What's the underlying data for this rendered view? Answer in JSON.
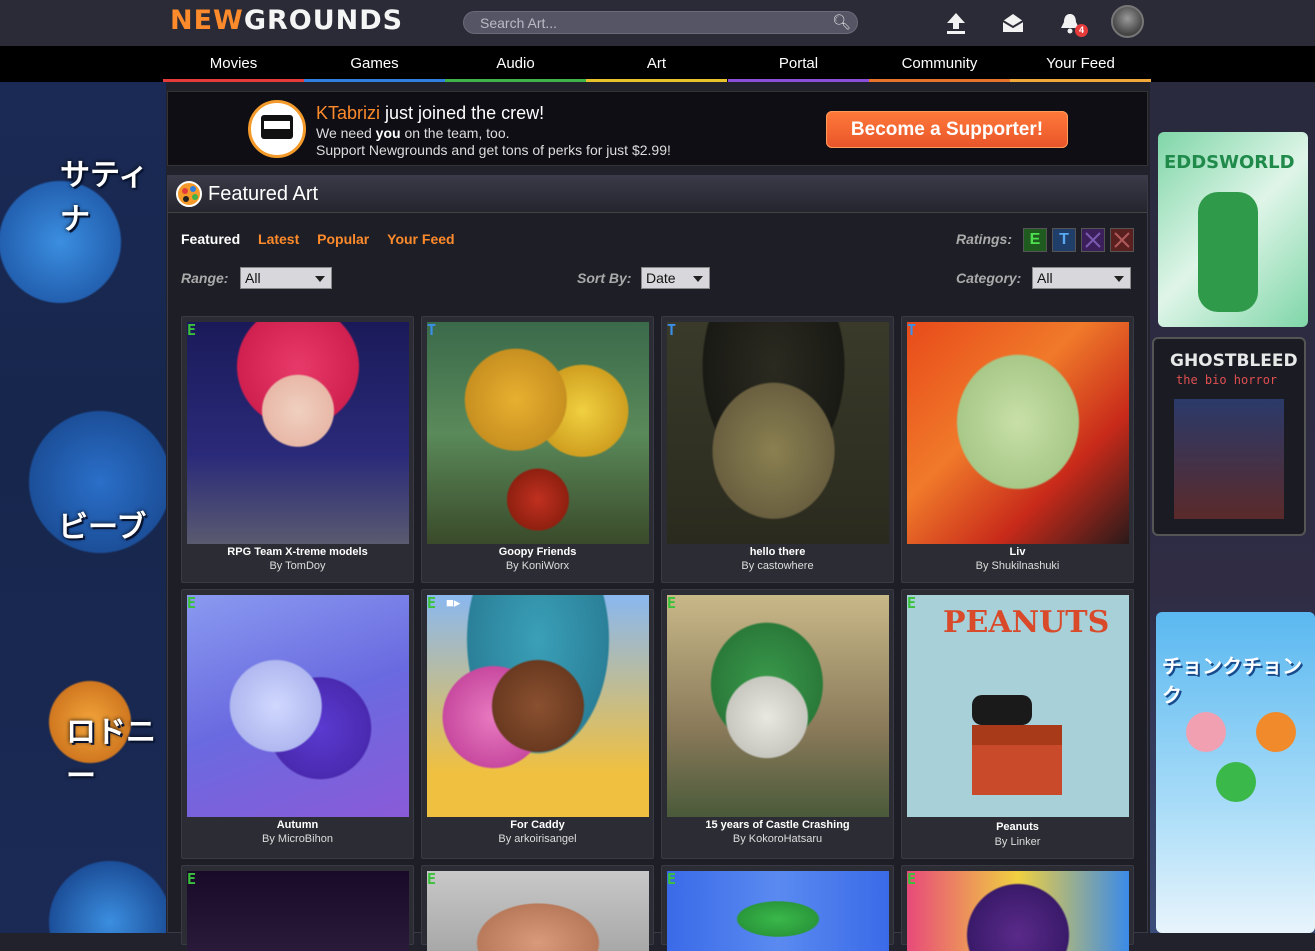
{
  "brand": {
    "logo_new": "NEW",
    "logo_grounds": "GROUNDS"
  },
  "search": {
    "placeholder": "Search Art..."
  },
  "notifications": {
    "count": "4"
  },
  "nav": [
    {
      "label": "Movies",
      "color": "#e53b3b"
    },
    {
      "label": "Games",
      "color": "#2f7fe0"
    },
    {
      "label": "Audio",
      "color": "#3fb24a"
    },
    {
      "label": "Art",
      "color": "#e8c22a"
    },
    {
      "label": "Portal",
      "color": "#8a4fd8"
    },
    {
      "label": "Community",
      "color": "#e8732a"
    },
    {
      "label": "Your Feed",
      "color": "#f2a93a"
    }
  ],
  "banner": {
    "username": "KTabrizi",
    "joined_text": " just joined the crew!",
    "line2_pre": "We need ",
    "line2_bold": "you",
    "line2_post": " on the team, too.",
    "line3": "Support Newgrounds and get tons of perks for just $2.99!",
    "button": "Become a Supporter!"
  },
  "panel": {
    "title": "Featured Art",
    "tabs": [
      "Featured",
      "Latest",
      "Popular",
      "Your Feed"
    ],
    "ratings_label": "Ratings:",
    "ratings": [
      "E",
      "T",
      "M",
      "A"
    ],
    "range_label": "Range:",
    "range_value": "All",
    "sort_label": "Sort By:",
    "sort_value": "Date",
    "category_label": "Category:",
    "category_value": "All"
  },
  "art": [
    {
      "title": "RPG Team X-treme models",
      "author": "By TomDoy",
      "rating": "E",
      "video": false
    },
    {
      "title": "Goopy Friends",
      "author": "By KoniWorx",
      "rating": "T",
      "video": false
    },
    {
      "title": "hello there",
      "author": "By castowhere",
      "rating": "T",
      "video": false
    },
    {
      "title": "Liv",
      "author": "By Shukilnashuki",
      "rating": "T",
      "video": false
    },
    {
      "title": "Autumn",
      "author": "By MicroBihon",
      "rating": "E",
      "video": false
    },
    {
      "title": "For Caddy",
      "author": "By arkoirisangel",
      "rating": "E",
      "video": true
    },
    {
      "title": "15 years of Castle Crashing",
      "author": "By KokoroHatsaru",
      "rating": "E",
      "video": false
    },
    {
      "title": "Peanuts",
      "author": "By Linker",
      "rating": "E",
      "video": false
    },
    {
      "title": "",
      "author": "",
      "rating": "E",
      "video": false
    },
    {
      "title": "",
      "author": "",
      "rating": "E",
      "video": false
    },
    {
      "title": "",
      "author": "",
      "rating": "E",
      "video": false
    },
    {
      "title": "",
      "author": "",
      "rating": "E",
      "video": false
    }
  ],
  "side_left_text": [
    "サティナ",
    "ビーブ",
    "ロドニー"
  ],
  "side_right_text": [
    "EDDSWORLD",
    "GHOSTBLEED",
    "the bio horror",
    "チョンクチョンク"
  ],
  "peanuts_text": "PEANUTS"
}
